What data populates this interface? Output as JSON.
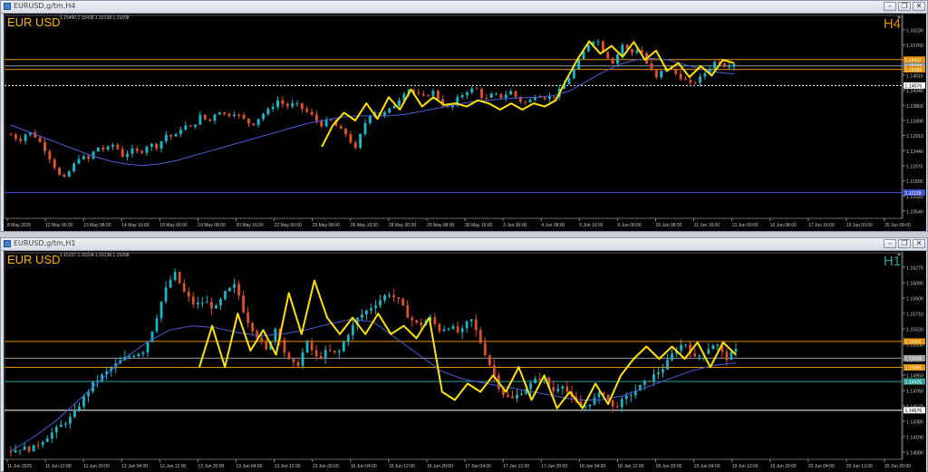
{
  "windows": [
    {
      "title": "EURUSD,g/tm,H4",
      "ohlc_text": "1.15460 1.15438 1.15138 1.15208",
      "symbol": "EUR USD",
      "timeframe": "H4",
      "timeframe_color": "#e58f00",
      "price_ticks": [
        "1.16230",
        "1.15760",
        "1.15290",
        "1.14810",
        "1.14340",
        "1.13860",
        "1.13390",
        "1.12910",
        "1.12440",
        "1.11970",
        "1.11500",
        "1.11020",
        "1.10540"
      ],
      "time_ticks": [
        "8 May 2025",
        "12 May 00:00",
        "13 May 08:00",
        "14 May 16:00",
        "16 May 00:00",
        "19 May 08:00",
        "20 May 16:00",
        "22 May 00:00",
        "23 May 08:00",
        "26 May 16:00",
        "28 May 00:00",
        "29 May 08:00",
        "30 May 16:00",
        "3 Jun 00:00",
        "4 Jun 08:00",
        "5 Jun 16:00",
        "9 Jun 00:00",
        "10 Jun 08:00",
        "11 Jun 16:00",
        "13 Jun 00:00",
        "16 Jun 08:00",
        "17 Jun 16:00",
        "19 Jun 00:00",
        "20 Jun 08:00"
      ],
      "level_labels": [
        "1.15411",
        "1.15208",
        "1.15096",
        "1.14576",
        "1.11129"
      ],
      "chart_data": {
        "type": "candlestick",
        "timeframe": "H4",
        "ylim": [
          1.103,
          1.166
        ],
        "levels": [
          {
            "value": 1.15411,
            "color": "#e58f00",
            "label": "1.15411"
          },
          {
            "value": 1.15208,
            "color": "#9a9a9a",
            "label": "1.15208"
          },
          {
            "value": 1.15096,
            "color": "#e58f00",
            "label": "1.15096"
          },
          {
            "value": 1.14576,
            "color": "#ffffff",
            "label": "1.14576",
            "dashed": true
          },
          {
            "value": 1.11129,
            "color": "#3f55d6",
            "label": "1.11129"
          }
        ],
        "close_path": [
          1.13,
          1.128,
          1.131,
          1.129,
          1.125,
          1.12,
          1.115,
          1.119,
          1.123,
          1.122,
          1.126,
          1.125,
          1.127,
          1.123,
          1.125,
          1.124,
          1.127,
          1.126,
          1.13,
          1.129,
          1.133,
          1.132,
          1.136,
          1.134,
          1.138,
          1.136,
          1.137,
          1.135,
          1.133,
          1.136,
          1.138,
          1.141,
          1.139,
          1.14,
          1.138,
          1.136,
          1.133,
          1.135,
          1.132,
          1.13,
          1.125,
          1.133,
          1.138,
          1.136,
          1.138,
          1.141,
          1.145,
          1.143,
          1.142,
          1.144,
          1.14,
          1.138,
          1.142,
          1.144,
          1.145,
          1.141,
          1.143,
          1.142,
          1.144,
          1.141,
          1.14,
          1.143,
          1.142,
          1.142,
          1.145,
          1.149,
          1.154,
          1.159,
          1.161,
          1.156,
          1.153,
          1.159,
          1.156,
          1.158,
          1.152,
          1.148,
          1.152,
          1.15,
          1.148,
          1.146,
          1.148,
          1.151,
          1.154,
          1.152,
          1.153
        ],
        "ma_path": [
          1.133,
          1.131,
          1.129,
          1.127,
          1.125,
          1.123,
          1.1215,
          1.1205,
          1.12,
          1.1205,
          1.1215,
          1.123,
          1.1245,
          1.126,
          1.1275,
          1.129,
          1.1305,
          1.132,
          1.1335,
          1.1345,
          1.1355,
          1.136,
          1.136,
          1.136,
          1.1365,
          1.1375,
          1.1385,
          1.1395,
          1.1405,
          1.141,
          1.1415,
          1.1418,
          1.142,
          1.1425,
          1.144,
          1.147,
          1.15,
          1.1525,
          1.154,
          1.1545,
          1.154,
          1.1525,
          1.151,
          1.15,
          1.1495
        ],
        "zigzag": [
          1.126,
          1.133,
          1.137,
          1.1345,
          1.14,
          1.135,
          1.142,
          1.138,
          1.1445,
          1.139,
          1.142,
          1.1395,
          1.14,
          1.139,
          1.141,
          1.14,
          1.138,
          1.14,
          1.138,
          1.14,
          1.139,
          1.141,
          1.148,
          1.1545,
          1.16,
          1.156,
          1.1585,
          1.155,
          1.1598,
          1.154,
          1.157,
          1.1505,
          1.153,
          1.1485,
          1.152,
          1.149,
          1.154,
          1.153
        ]
      }
    },
    {
      "title": "EURUSD,g/tm,H1",
      "ohlc_text": "1.15157 1.15224 1.15138 1.15208",
      "symbol": "EUR USD",
      "timeframe": "H1",
      "timeframe_color": "#2fa19b",
      "price_ticks": [
        "1.16275",
        "1.16090",
        "1.15900",
        "1.15710",
        "1.15520",
        "1.15330",
        "1.15130",
        "1.14950",
        "1.14760",
        "1.14570",
        "1.14380",
        "1.14190",
        "1.14000"
      ],
      "time_ticks": [
        "11 Jun 2025",
        "11 Jun 12:00",
        "11 Jun 20:00",
        "12 Jun 04:00",
        "12 Jun 12:00",
        "12 Jun 20:00",
        "13 Jun 04:00",
        "13 Jun 12:00",
        "13 Jun 20:00",
        "16 Jun 04:00",
        "16 Jun 12:00",
        "16 Jun 20:00",
        "17 Jun 04:00",
        "17 Jun 12:00",
        "17 Jun 20:00",
        "18 Jun 04:00",
        "18 Jun 12:00",
        "18 Jun 20:00",
        "19 Jun 04:00",
        "19 Jun 12:00",
        "19 Jun 20:00",
        "20 Jun 04:00",
        "20 Jun 12:00",
        "20 Jun 20:00"
      ],
      "level_labels": [
        "1.15411",
        "1.15208",
        "1.15096",
        "1.14576",
        "1.14925"
      ],
      "chart_data": {
        "type": "candlestick",
        "timeframe": "H1",
        "ylim": [
          1.1398,
          1.164
        ],
        "levels": [
          {
            "value": 1.15411,
            "color": "#e58f00",
            "label": "1.15411"
          },
          {
            "value": 1.15208,
            "color": "#9a9a9a",
            "label": "1.15208"
          },
          {
            "value": 1.15096,
            "color": "#e58f00",
            "label": "1.15096"
          },
          {
            "value": 1.14925,
            "color": "#2fa19b",
            "label": "1.14925"
          },
          {
            "value": 1.14576,
            "color": "#ffffff",
            "label": "1.14576"
          }
        ],
        "close_path": [
          1.1408,
          1.1412,
          1.141,
          1.142,
          1.143,
          1.144,
          1.145,
          1.147,
          1.149,
          1.15,
          1.151,
          1.152,
          1.1525,
          1.153,
          1.156,
          1.16,
          1.1625,
          1.16,
          1.1585,
          1.159,
          1.158,
          1.16,
          1.161,
          1.157,
          1.155,
          1.153,
          1.156,
          1.152,
          1.151,
          1.154,
          1.152,
          1.153,
          1.1525,
          1.155,
          1.157,
          1.158,
          1.159,
          1.16,
          1.159,
          1.157,
          1.156,
          1.157,
          1.1555,
          1.156,
          1.155,
          1.157,
          1.154,
          1.151,
          1.148,
          1.147,
          1.148,
          1.149,
          1.15,
          1.148,
          1.149,
          1.147,
          1.146,
          1.147,
          1.148,
          1.146,
          1.147,
          1.148,
          1.149,
          1.15,
          1.151,
          1.153,
          1.154,
          1.152,
          1.153,
          1.154,
          1.152,
          1.153
        ],
        "ma_path": [
          1.1408,
          1.1425,
          1.1445,
          1.147,
          1.1495,
          1.152,
          1.154,
          1.1555,
          1.156,
          1.1558,
          1.1552,
          1.1548,
          1.155,
          1.1555,
          1.1562,
          1.1568,
          1.1565,
          1.1545,
          1.1525,
          1.1505,
          1.1495,
          1.149,
          1.1485,
          1.148,
          1.1475,
          1.147,
          1.147,
          1.1475,
          1.1485,
          1.1495,
          1.1505,
          1.1512,
          1.1515
        ],
        "zigzag": [
          1.151,
          1.156,
          1.151,
          1.1575,
          1.153,
          1.1555,
          1.1525,
          1.16,
          1.155,
          1.1615,
          1.157,
          1.155,
          1.157,
          1.155,
          1.1575,
          1.155,
          1.156,
          1.1545,
          1.157,
          1.148,
          1.147,
          1.149,
          1.148,
          1.15,
          1.148,
          1.151,
          1.147,
          1.15,
          1.146,
          1.148,
          1.146,
          1.149,
          1.1465,
          1.15,
          1.152,
          1.1535,
          1.152,
          1.1535,
          1.152,
          1.154,
          1.151,
          1.154,
          1.1525
        ]
      }
    }
  ],
  "colors": {
    "bull": "#19b8c9",
    "bear": "#e0512b",
    "ma": "#4a5cd6",
    "zigzag": "#ffe400",
    "symbol": "#ffb400",
    "axis_text": "#c8c8c8"
  },
  "window_buttons": {
    "minimize": "–",
    "restore": "❐",
    "close": "✕"
  }
}
